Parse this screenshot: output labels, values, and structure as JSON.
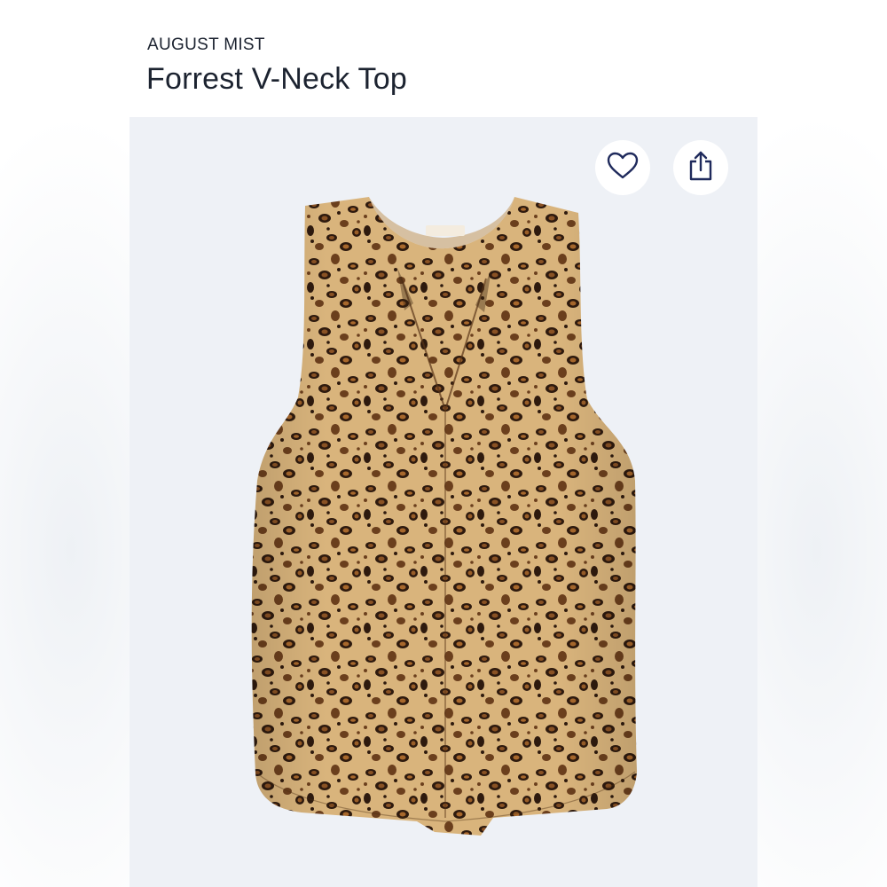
{
  "product": {
    "brand": "AUGUST MIST",
    "name": "Forrest V-Neck Top"
  },
  "actions": {
    "favorite_icon": "heart-outline-icon",
    "share_icon": "share-upload-icon"
  },
  "colors": {
    "text": "#1c2330",
    "icon": "#1f2a5c",
    "image_background": "#eef1f6",
    "print_base": "#d9b47c",
    "print_spot": "#6b3f1d",
    "print_dark": "#2e1a0e"
  }
}
